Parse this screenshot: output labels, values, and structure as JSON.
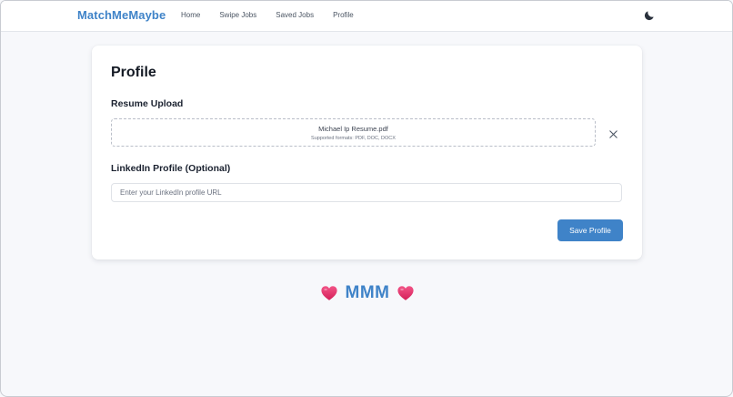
{
  "header": {
    "brand": "MatchMeMaybe",
    "nav": [
      {
        "label": "Home"
      },
      {
        "label": "Swipe Jobs"
      },
      {
        "label": "Saved Jobs"
      },
      {
        "label": "Profile"
      }
    ],
    "theme_toggle_icon": "moon-icon"
  },
  "profile": {
    "title": "Profile",
    "resume": {
      "heading": "Resume Upload",
      "file_name": "Michael Ip Resume.pdf",
      "formats": "Supported formats: PDF, DOC, DOCX",
      "remove_icon": "close-icon"
    },
    "linkedin": {
      "heading": "LinkedIn Profile (Optional)",
      "value": "",
      "placeholder": "Enter your LinkedIn profile URL"
    },
    "save_label": "Save Profile"
  },
  "footer": {
    "text": "MMM",
    "icon": "heart-icon"
  },
  "colors": {
    "accent": "#3f83c8",
    "heart": "#e8336d"
  }
}
